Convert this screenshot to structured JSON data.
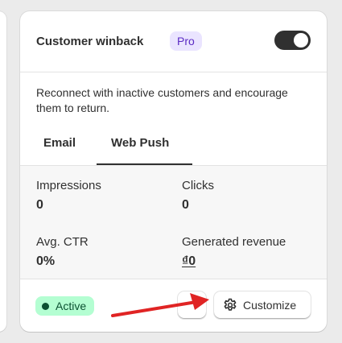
{
  "card": {
    "title": "Customer winback",
    "badge": "Pro",
    "toggle_on": true,
    "description": "Reconnect with inactive customers and encourage them to return.",
    "tabs": [
      {
        "label": "Email",
        "selected": false
      },
      {
        "label": "Web Push",
        "selected": true
      }
    ],
    "stats": [
      {
        "label": "Impressions",
        "value": "0"
      },
      {
        "label": "Clicks",
        "value": "0"
      },
      {
        "label": "Avg. CTR",
        "value": "0%"
      },
      {
        "label": "Generated revenue",
        "value": "₫0"
      }
    ],
    "status": "Active",
    "customize_label": "Customize"
  },
  "icons": [
    "gear-icon"
  ],
  "colors": {
    "pro_badge_bg": "#eae4ff",
    "pro_badge_text": "#5b2bc4",
    "active_badge_bg": "#b4fed2",
    "active_badge_text": "#0c5132",
    "annotation_arrow": "#e02424"
  }
}
